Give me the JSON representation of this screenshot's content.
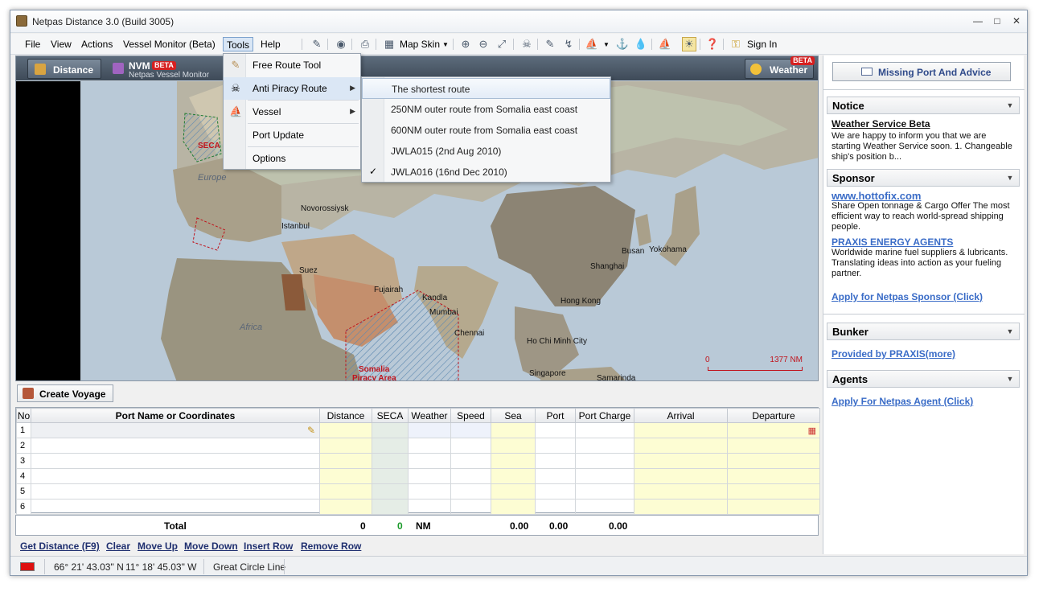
{
  "window": {
    "title": "Netpas Distance 3.0 (Build 3005)"
  },
  "menu": {
    "file": "File",
    "view": "View",
    "actions": "Actions",
    "vessel_monitor": "Vessel Monitor (Beta)",
    "tools": "Tools",
    "help": "Help",
    "map_skin": "Map Skin",
    "sign_in": "Sign In"
  },
  "tabs": {
    "distance": "Distance",
    "nvm": "NVM",
    "beta": "BETA",
    "nvm_sub": "Netpas Vessel Monitor",
    "weather": "Weather"
  },
  "tools_menu": [
    {
      "label": "Free Route Tool",
      "icon": "route-icon",
      "submenu": false
    },
    {
      "label": "Anti Piracy Route",
      "icon": "pirate-icon",
      "submenu": true
    },
    {
      "label": "Vessel",
      "icon": "ship-icon",
      "submenu": true
    },
    {
      "label": "Port Update",
      "icon": "",
      "submenu": false
    },
    {
      "label": "Options",
      "icon": "",
      "submenu": false
    }
  ],
  "piracy_submenu": [
    {
      "label": "The shortest route",
      "checked": false
    },
    {
      "label": "250NM outer route from Somalia east coast",
      "checked": false
    },
    {
      "label": "600NM outer route from Somalia east coast",
      "checked": false
    },
    {
      "label": "JWLA015 (2nd Aug 2010)",
      "checked": false
    },
    {
      "label": "JWLA016 (16nd Dec 2010)",
      "checked": true
    }
  ],
  "map": {
    "regions": {
      "europe": "Europe",
      "africa": "Africa"
    },
    "seca_label": "SECA",
    "somalia_1": "Somalia",
    "somalia_2": "Piracy Area",
    "cities": {
      "novorossiysk": "Novorossiysk",
      "istanbul": "Istanbul",
      "suez": "Suez",
      "fujairah": "Fujairah",
      "kandla": "Kandla",
      "mumbai": "Mumbai",
      "chennai": "Chennai",
      "busan": "Busan",
      "yokohama": "Yokohama",
      "shanghai": "Shanghai",
      "hongkong": "Hong Kong",
      "hochiminh": "Ho Chi Minh City",
      "singapore": "Singapore",
      "samarinda": "Samarinda"
    },
    "scale_start": "0",
    "scale_end": "1377 NM"
  },
  "voyage": {
    "create_label": "Create Voyage"
  },
  "grid": {
    "headers": [
      "No",
      "Port Name or Coordinates",
      "Distance",
      "SECA",
      "Weather",
      "Speed",
      "Sea",
      "Port",
      "Port Charge",
      "Arrival",
      "Departure"
    ],
    "rows": [
      "1",
      "2",
      "3",
      "4",
      "5",
      "6"
    ]
  },
  "totals": {
    "label": "Total",
    "distance": "0",
    "seca": "0",
    "unit": "NM",
    "sea": "0.00",
    "port": "0.00",
    "port_charge": "0.00"
  },
  "actions": {
    "get_distance": "Get Distance (F9)",
    "clear": "Clear",
    "move_up": "Move Up",
    "move_down": "Move Down",
    "insert_row": "Insert Row",
    "remove_row": "Remove Row"
  },
  "status": {
    "lat": "66° 21' 43.03\" N",
    "lon": "11° 18' 45.03\" W",
    "mode": "Great Circle Line"
  },
  "sidebar": {
    "missing_port": "Missing Port And Advice",
    "notice": {
      "title": "Notice",
      "item_title": "Weather Service Beta",
      "item_text": "We are happy to inform you that we are starting Weather Service soon. 1. Changeable ship's position b..."
    },
    "sponsor": {
      "title": "Sponsor",
      "link1": "www.hottofix.com",
      "text1": "Share Open tonnage & Cargo Offer The most efficient way to reach world-spread shipping people.",
      "link2": "PRAXIS ENERGY AGENTS",
      "text2": "Worldwide marine fuel suppliers & lubricants. Translating ideas into action as your fueling partner.",
      "apply": "Apply for Netpas Sponsor (Click)"
    },
    "bunker": {
      "title": "Bunker",
      "link": "Provided by PRAXIS(more)"
    },
    "agents": {
      "title": "Agents",
      "link": "Apply For Netpas Agent (Click)"
    }
  },
  "colors": {
    "accent": "#3a6cc7",
    "seca": "#c0141d",
    "yellow_cell": "#fdfdd3"
  }
}
